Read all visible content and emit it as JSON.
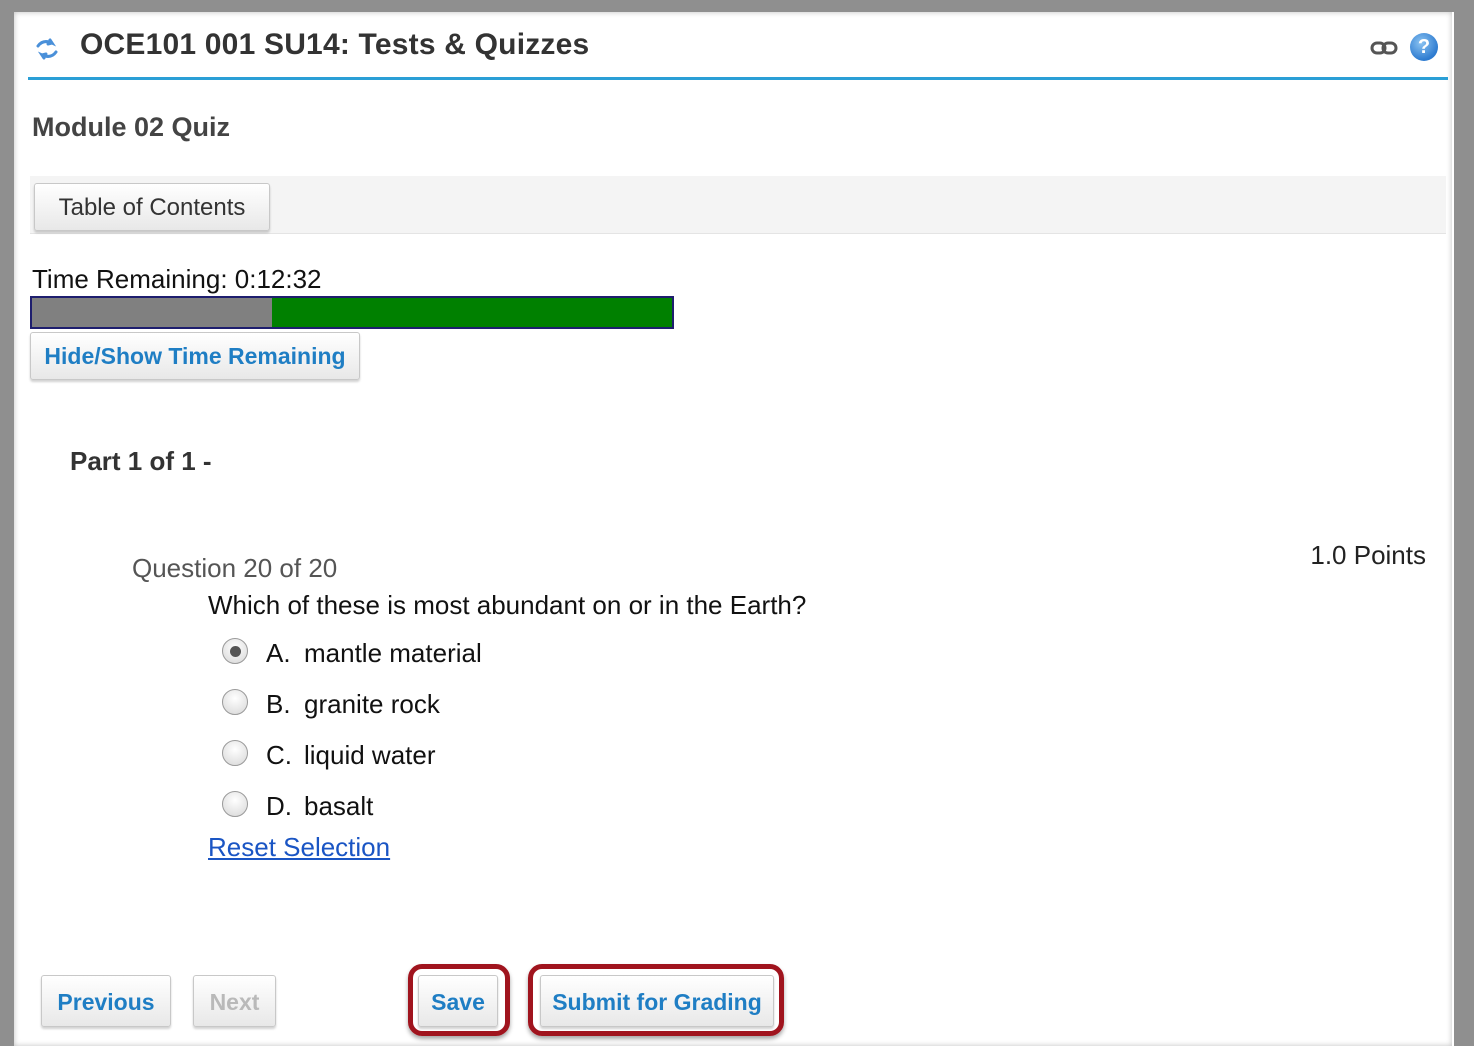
{
  "header": {
    "title": "OCE101 001 SU14: Tests & Quizzes",
    "reset_icon": "reset-icon",
    "link_icon": "link-icon",
    "help_icon": "help-icon",
    "help_glyph": "?",
    "accent_color": "#2a9fd6"
  },
  "quiz": {
    "title": "Module 02 Quiz",
    "toc_button": "Table of Contents"
  },
  "timer": {
    "label": "Time Remaining: 0:12:32",
    "elapsed_fraction": 0.375,
    "hide_show_button": "Hide/Show Time Remaining"
  },
  "part": {
    "title": "Part 1 of 1 -"
  },
  "question": {
    "number": "Question 20 of 20",
    "points": "1.0 Points",
    "text": "Which of these is most abundant on or in the Earth?",
    "answers": [
      {
        "letter": "A.",
        "text": "mantle material",
        "selected": true
      },
      {
        "letter": "B.",
        "text": "granite rock",
        "selected": false
      },
      {
        "letter": "C.",
        "text": "liquid water",
        "selected": false
      },
      {
        "letter": "D.",
        "text": "basalt",
        "selected": false
      }
    ],
    "reset_link": "Reset Selection"
  },
  "nav": {
    "previous": "Previous",
    "next": "Next",
    "save": "Save",
    "submit": "Submit for Grading"
  }
}
